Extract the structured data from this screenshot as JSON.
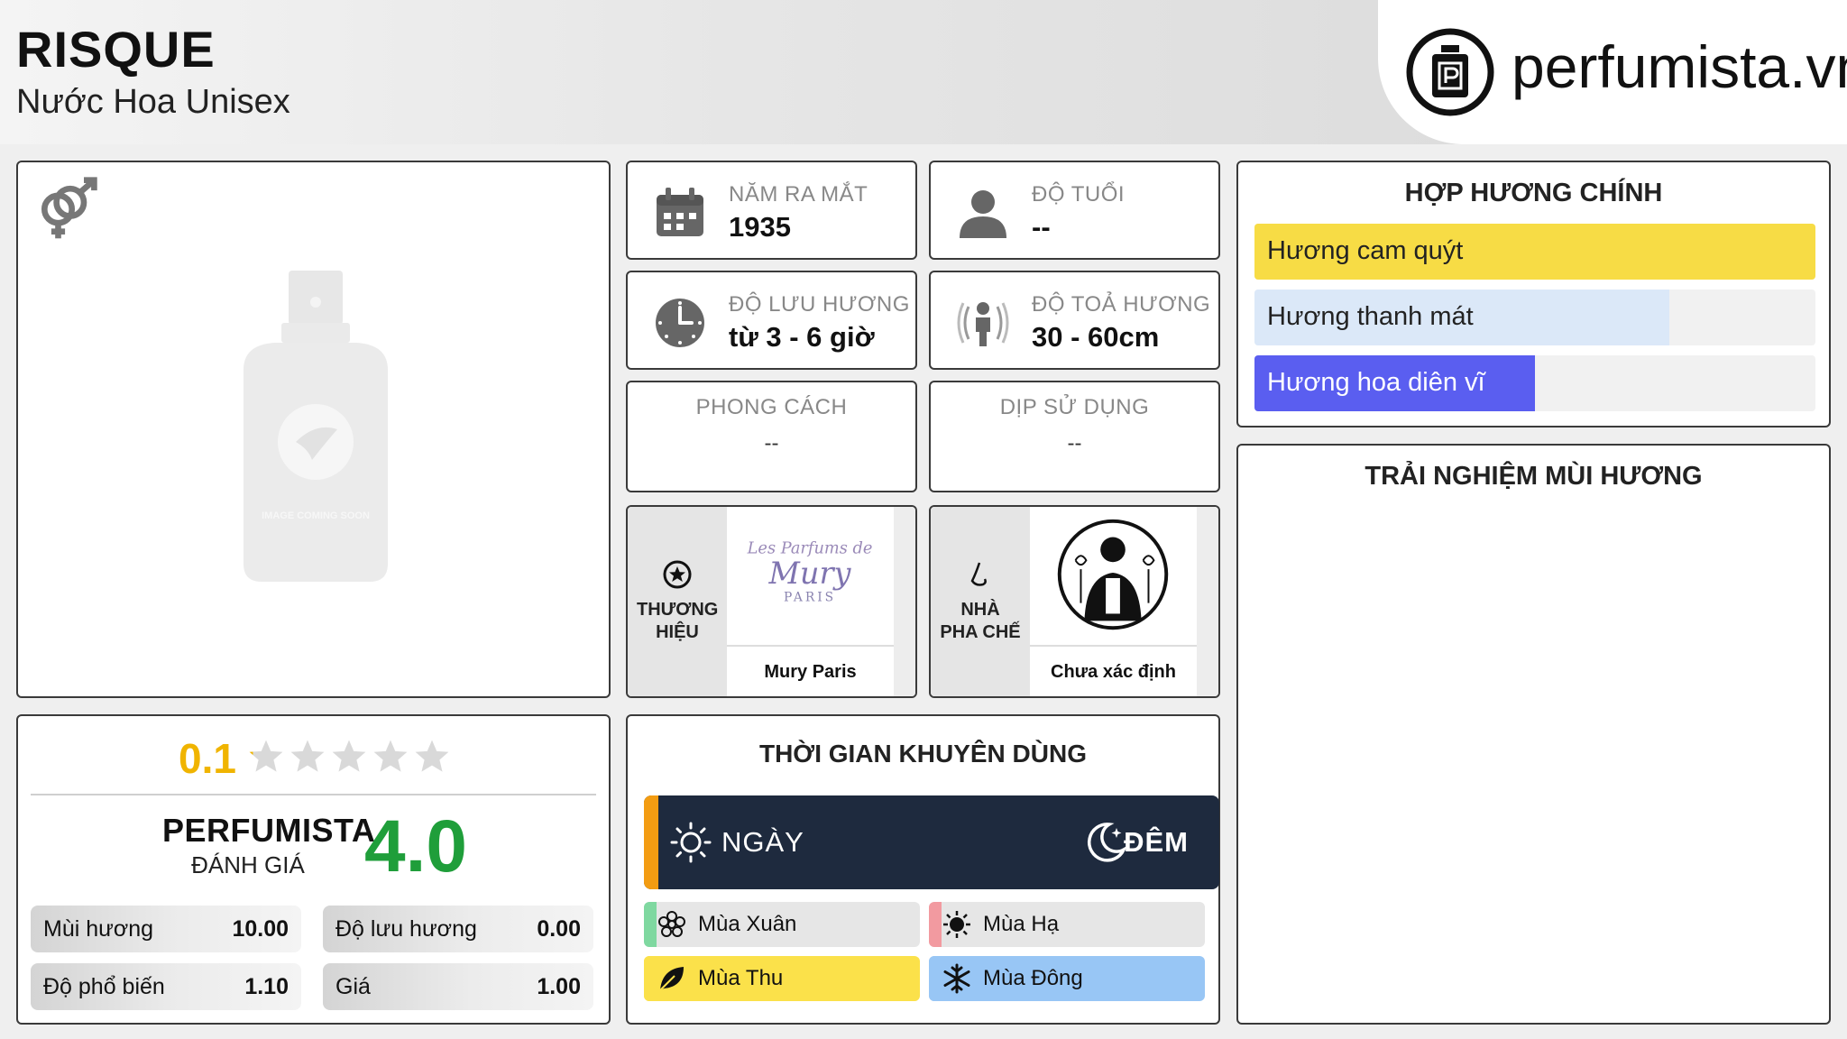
{
  "header": {
    "title": "RISQUE",
    "subtitle": "Nước Hoa Unisex",
    "logo_text": "perfumista.vn"
  },
  "product_image": {
    "placeholder_text": "IMAGE COMING SOON",
    "gender_icon": "unisex-gender-icon"
  },
  "info": {
    "release_year": {
      "label": "NĂM RA MẮT",
      "value": "1935",
      "icon": "calendar-icon"
    },
    "age": {
      "label": "ĐỘ TUỔI",
      "value": "--",
      "icon": "person-icon"
    },
    "longevity": {
      "label": "ĐỘ LƯU HƯƠNG",
      "value": "từ 3 - 6 giờ",
      "icon": "clock-icon"
    },
    "sillage": {
      "label": "ĐỘ TOẢ HƯƠNG",
      "value": "30 - 60cm",
      "icon": "radiating-person-icon"
    },
    "style": {
      "label": "PHONG CÁCH",
      "value": "--"
    },
    "occasion": {
      "label": "DỊP SỬ DỤNG",
      "value": "--"
    }
  },
  "brand": {
    "label": "THƯƠNG HIỆU",
    "name": "Mury Paris",
    "logo_line1": "Les Parfums de",
    "logo_line2": "Mury",
    "logo_line3": "PARIS"
  },
  "perfumer": {
    "label": "NHÀ PHA CHẾ",
    "name": "Chưa xác định"
  },
  "rating": {
    "user_score": "0.1",
    "user_stars_filled": 0.02,
    "perfumista_label": "PERFUMISTA",
    "perfumista_sub": "ĐÁNH GIÁ",
    "perfumista_score": "4.0",
    "stats": [
      {
        "label": "Mùi hương",
        "value": "10.00"
      },
      {
        "label": "Độ lưu hương",
        "value": "0.00"
      },
      {
        "label": "Độ phổ biến",
        "value": "1.10"
      },
      {
        "label": "Giá",
        "value": "1.00"
      }
    ]
  },
  "time": {
    "title": "THỜI GIAN KHUYÊN DÙNG",
    "day": "NGÀY",
    "night": "ĐÊM",
    "seasons": [
      {
        "label": "Mùa Xuân",
        "color": "#e6e6e6",
        "tab": "#7fd8a0",
        "icon": "flower-icon"
      },
      {
        "label": "Mùa Hạ",
        "color": "#e6e6e6",
        "tab": "#f29aa0",
        "icon": "sun-icon"
      },
      {
        "label": "Mùa Thu",
        "color": "#fbe14a",
        "tab": "#fbe14a",
        "icon": "leaf-icon"
      },
      {
        "label": "Mùa Đông",
        "color": "#98c6f5",
        "tab": "#98c6f5",
        "icon": "snowflake-icon"
      }
    ]
  },
  "accords": {
    "title": "HỢP HƯƠNG CHÍNH",
    "items": [
      {
        "label": "Hương cam quýt",
        "level": 1.0,
        "color": "#f7dc45",
        "text_color": "#222"
      },
      {
        "label": "Hương thanh mát",
        "level": 0.74,
        "color": "#dbe8f8",
        "text_color": "#222"
      },
      {
        "label": "Hương hoa diên vĩ",
        "level": 0.5,
        "color": "#5a5ef0",
        "text_color": "#ffffff"
      }
    ]
  },
  "experience": {
    "title": "TRẢI NGHIỆM MÙI HƯƠNG"
  },
  "colors": {
    "perfumista_score": "#1f9e3a",
    "user_score": "#f0b400",
    "daynight_bg": "#1e2a3e",
    "day_accent": "#f39c12"
  }
}
